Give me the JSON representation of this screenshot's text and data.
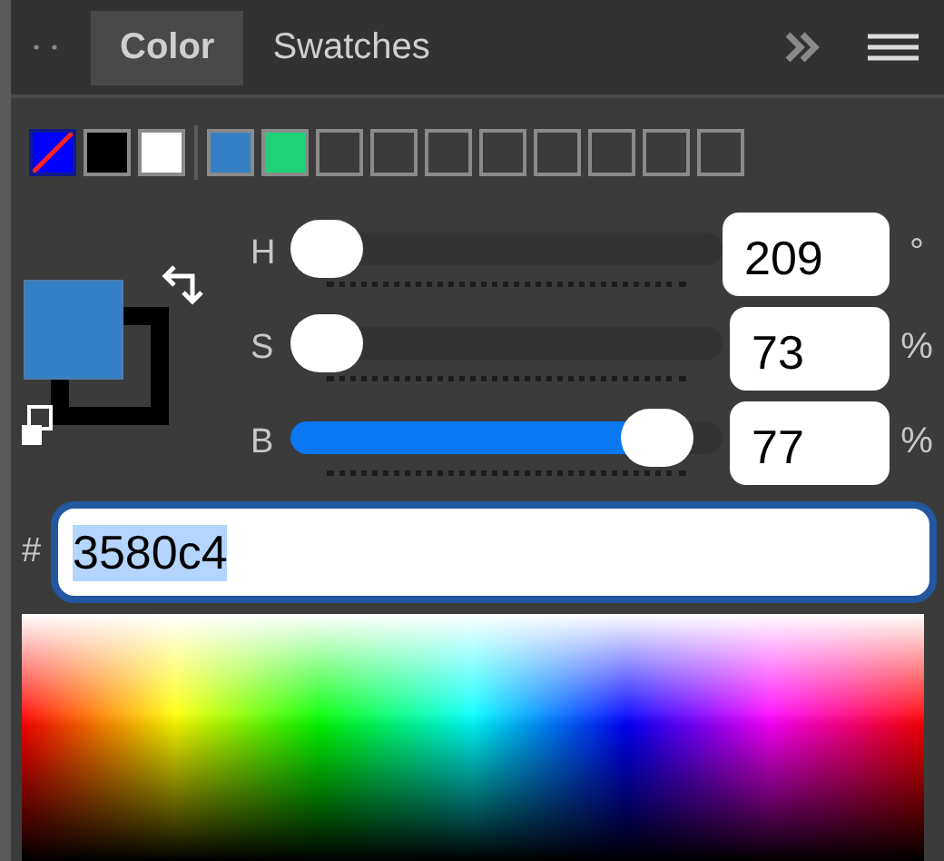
{
  "tabs": [
    {
      "label": "Color",
      "selected": true
    },
    {
      "label": "Swatches",
      "selected": false
    }
  ],
  "default_swatches": [
    {
      "kind": "none"
    },
    {
      "kind": "color",
      "color": "#000000"
    },
    {
      "kind": "color",
      "color": "#ffffff"
    }
  ],
  "recent_swatches": [
    {
      "kind": "color",
      "color": "#3580c4"
    },
    {
      "kind": "color",
      "color": "#1fd27a"
    },
    {
      "kind": "empty"
    },
    {
      "kind": "empty"
    },
    {
      "kind": "empty"
    },
    {
      "kind": "empty"
    },
    {
      "kind": "empty"
    },
    {
      "kind": "empty"
    },
    {
      "kind": "empty"
    },
    {
      "kind": "empty"
    }
  ],
  "active_colors": [
    {
      "kind": "foreground",
      "color": "#3580c4"
    },
    {
      "kind": "background",
      "color": "#000000"
    }
  ],
  "sliders": [
    {
      "label": "H",
      "level": 0.0,
      "value": "209",
      "unit": "°"
    },
    {
      "label": "S",
      "level": 0.0,
      "value": "73",
      "unit": "%"
    },
    {
      "label": "B",
      "level": 0.92,
      "value": "77",
      "unit": "%"
    }
  ],
  "hex": {
    "label": "#",
    "value": "3580c4",
    "text_selected": true
  }
}
